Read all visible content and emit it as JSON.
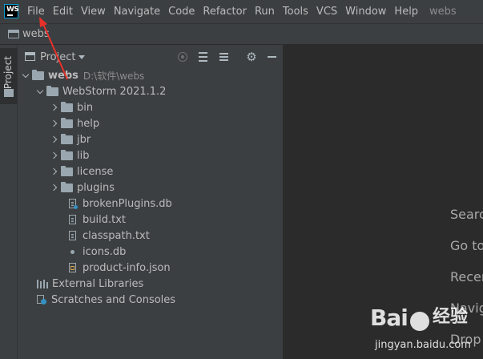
{
  "app": {
    "logo_text": "WS"
  },
  "menubar": {
    "items": [
      "File",
      "Edit",
      "View",
      "Navigate",
      "Code",
      "Refactor",
      "Run",
      "Tools",
      "VCS",
      "Window",
      "Help"
    ],
    "window_title": "webs"
  },
  "navbar": {
    "project": "webs"
  },
  "tool_stripe": {
    "project_tab": "Project"
  },
  "panel": {
    "title": "Project"
  },
  "tree": {
    "root": {
      "name": "webs",
      "path": "D:\\软件\\webs"
    },
    "webstorm": "WebStorm 2021.1.2",
    "folders": [
      "bin",
      "help",
      "jbr",
      "lib",
      "license",
      "plugins"
    ],
    "files": [
      "brokenPlugins.db",
      "build.txt",
      "classpath.txt",
      "icons.db",
      "product-info.json"
    ],
    "external_libraries": "External Libraries",
    "scratches": "Scratches and Consoles"
  },
  "editor_hints": [
    "Searc",
    "Go to",
    "Recer",
    "Navig",
    "Drop"
  ],
  "watermark": {
    "logo": "Bai",
    "brand": "经验",
    "url": "jingyan.baidu.com"
  },
  "colors": {
    "background": "#2b2b2b",
    "panel": "#3c3f41",
    "text": "#bbbbbb",
    "annotation": "#e8312a"
  }
}
